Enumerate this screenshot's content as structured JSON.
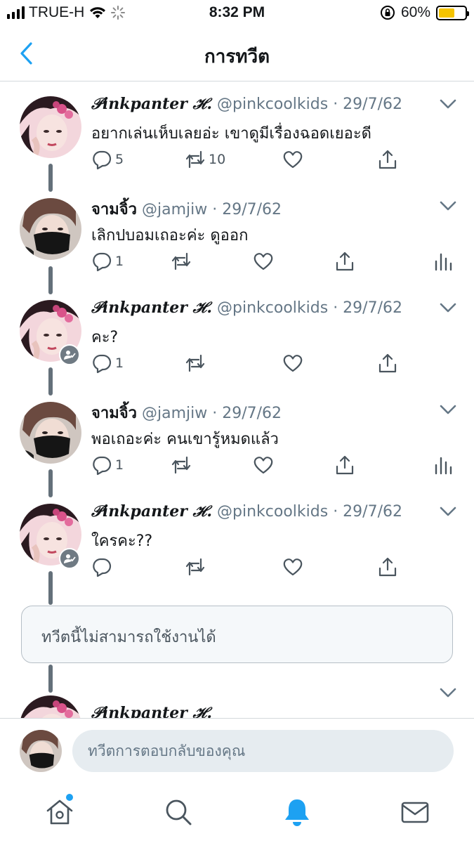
{
  "status_bar": {
    "carrier": "TRUE-H",
    "time": "8:32 PM",
    "battery_percent": "60%",
    "battery_level": 0.6,
    "battery_color": "#f5c400"
  },
  "header": {
    "title": "การทวีต",
    "back_icon": "chevron-left-icon"
  },
  "tweets": [
    {
      "name": "𝒫inkpanter ℋ.",
      "handle": "@pinkcoolkids",
      "date": "· 29/7/62",
      "text": "อยากเล่นเห็บเลยอ่ะ เขาดูมีเรื่องฉอดเยอะดี",
      "reply_count": "5",
      "retweet_count": "10",
      "avatar": "avatar-pink"
    },
    {
      "name": "จามจิ้ว",
      "handle": "@jamjiw",
      "date": "· 29/7/62",
      "text": "เลิกปบอมเถอะค่ะ ดูออก",
      "reply_count": "1",
      "retweet_count": "",
      "avatar": "avatar-mask"
    },
    {
      "name": "𝒫inkpanter ℋ.",
      "handle": "@pinkcoolkids",
      "date": "· 29/7/62",
      "text": "คะ?",
      "reply_count": "1",
      "retweet_count": "",
      "avatar": "avatar-pink"
    },
    {
      "name": "จามจิ้ว",
      "handle": "@jamjiw",
      "date": "· 29/7/62",
      "text": "พอเถอะค่ะ คนเขารู้หมดแล้ว",
      "reply_count": "1",
      "retweet_count": "",
      "avatar": "avatar-mask"
    },
    {
      "name": "𝒫inkpanter ℋ.",
      "handle": "@pinkcoolkids",
      "date": "· 29/7/62",
      "text": "ใครคะ??",
      "reply_count": "",
      "retweet_count": "",
      "avatar": "avatar-pink"
    }
  ],
  "unavailable_text": "ทวีตนี้ไม่สามารถใช้งานได้",
  "partial_tweet_name": "𝒫inkpanter ℋ.",
  "reply": {
    "placeholder": "ทวีตการตอบกลับของคุณ"
  },
  "tab_bar": {
    "tabs": [
      "home-icon",
      "search-icon",
      "notifications-icon",
      "messages-icon"
    ],
    "active_color": "#1da1f2"
  }
}
